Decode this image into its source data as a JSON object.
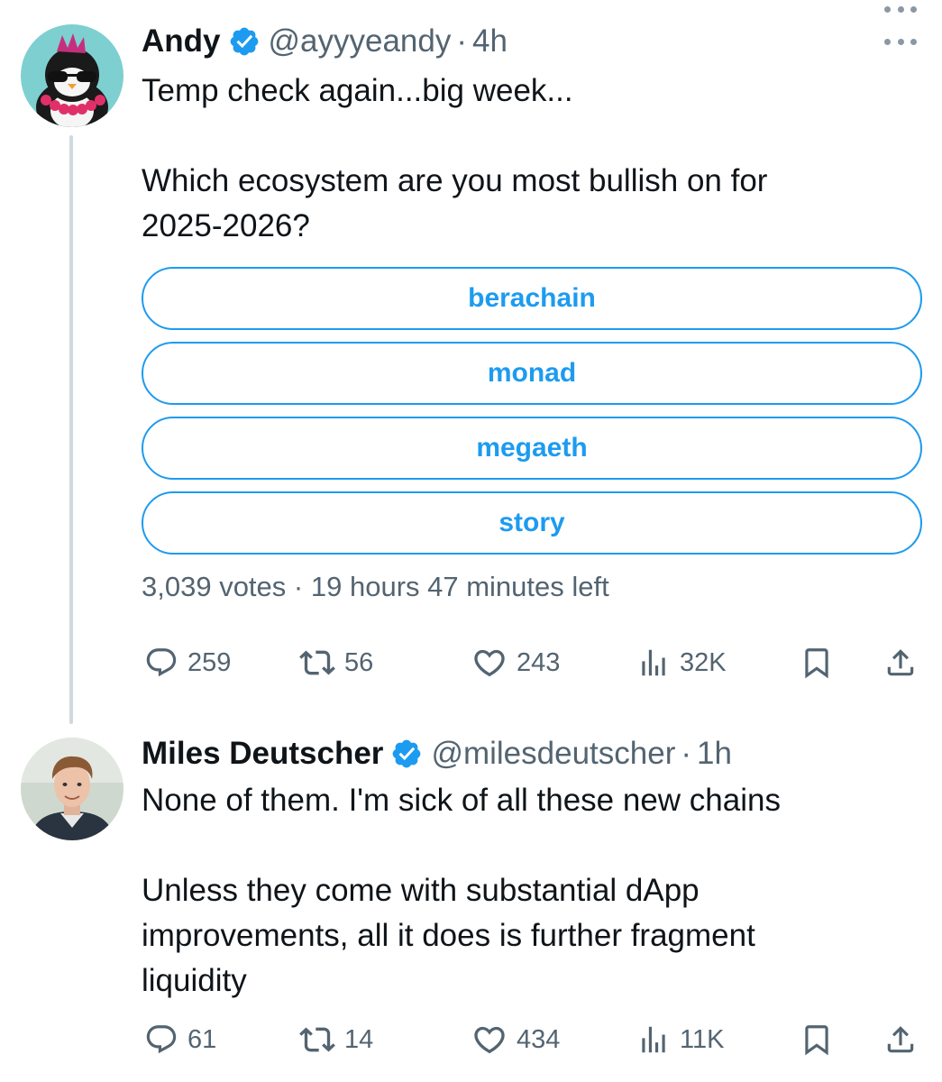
{
  "tweets": [
    {
      "author": {
        "name": "Andy",
        "handle": "@ayyyeandy",
        "verified": true,
        "avatar_icon": "penguin-avatar-icon"
      },
      "time": "4h",
      "text": [
        "Temp check again...big week...",
        "",
        "Which ecosystem are you most bullish on for",
        "2025-2026?"
      ],
      "poll": {
        "options": [
          "berachain",
          "monad",
          "megaeth",
          "story"
        ],
        "votes": "3,039 votes",
        "time_left": "19 hours 47 minutes left"
      },
      "stats": {
        "replies": "259",
        "reposts": "56",
        "likes": "243",
        "views": "32K"
      }
    },
    {
      "author": {
        "name": "Miles Deutscher",
        "handle": "@milesdeutscher",
        "verified": true,
        "avatar_icon": "profile-photo-avatar-icon"
      },
      "time": "1h",
      "text": [
        "None of them. I'm sick of all these new chains",
        "",
        "Unless they come with substantial dApp",
        "improvements, all it does is further fragment",
        "liquidity"
      ],
      "stats": {
        "replies": "61",
        "reposts": "14",
        "likes": "434",
        "views": "11K"
      }
    }
  ],
  "separator": "·",
  "colors": {
    "accent": "#1d9bf0",
    "text": "#0f1419",
    "secondary": "#536471",
    "thread_line": "#cfd9de"
  }
}
